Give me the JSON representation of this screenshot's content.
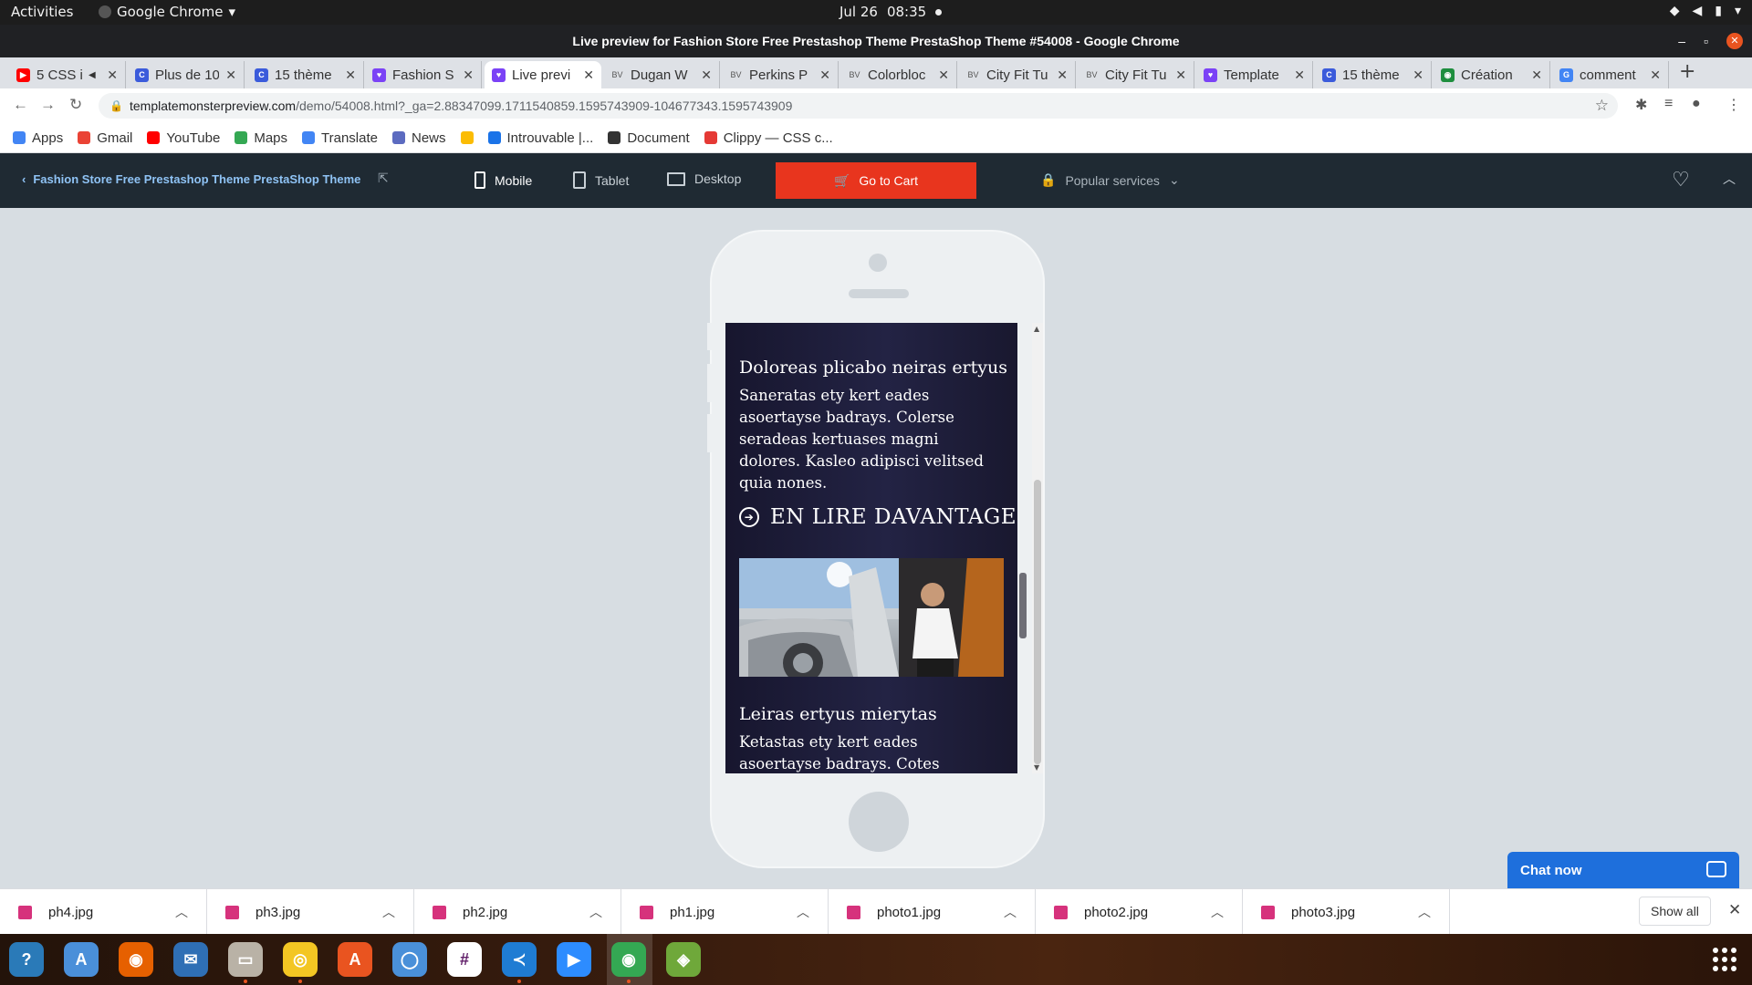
{
  "system_bar": {
    "activities": "Activities",
    "app_name": "Google Chrome",
    "date": "Jul 26",
    "time": "08:35"
  },
  "window": {
    "title": "Live preview for Fashion Store Free Prestashop Theme PrestaShop Theme #54008 - Google Chrome"
  },
  "tabs": [
    {
      "label": "5 CSS i",
      "icon": "youtube-icon",
      "color": "#ff0000",
      "muted": true
    },
    {
      "label": "Plus de 10",
      "icon": "c-icon",
      "color": "#3b5bdb"
    },
    {
      "label": "15 thème",
      "icon": "c-icon",
      "color": "#3b5bdb"
    },
    {
      "label": "Fashion S",
      "icon": "templatemonster-icon",
      "color": "#7b42f6"
    },
    {
      "label": "Live previ",
      "icon": "templatemonster-icon",
      "color": "#7b42f6",
      "active": true
    },
    {
      "label": "Dugan W",
      "icon": "bv-icon",
      "color": "#555555"
    },
    {
      "label": "Perkins P",
      "icon": "bv-icon",
      "color": "#555555"
    },
    {
      "label": "Colorbloc",
      "icon": "bv-icon",
      "color": "#555555"
    },
    {
      "label": "City Fit Tu",
      "icon": "bv-icon",
      "color": "#555555"
    },
    {
      "label": "City Fit Tu",
      "icon": "bv-icon",
      "color": "#555555"
    },
    {
      "label": "Template",
      "icon": "templatemonster-icon",
      "color": "#7b42f6"
    },
    {
      "label": "15 thème",
      "icon": "c-icon",
      "color": "#3b5bdb"
    },
    {
      "label": "Création",
      "icon": "globe-icon",
      "color": "#1e8e3e"
    },
    {
      "label": "comment",
      "icon": "google-icon",
      "color": "#4285f4"
    }
  ],
  "address_bar": {
    "domain": "templatemonsterpreview.com",
    "path": "/demo/54008.html?_ga=2.88347099.1711540859.1595743909-104677343.1595743909"
  },
  "bookmarks": [
    {
      "label": "Apps",
      "icon": "apps-grid-icon",
      "color": "#4285f4"
    },
    {
      "label": "Gmail",
      "icon": "gmail-icon",
      "color": "#ea4335"
    },
    {
      "label": "YouTube",
      "icon": "youtube-icon",
      "color": "#ff0000"
    },
    {
      "label": "Maps",
      "icon": "maps-icon",
      "color": "#34a853"
    },
    {
      "label": "Translate",
      "icon": "translate-icon",
      "color": "#4285f4"
    },
    {
      "label": "News",
      "icon": "news-icon",
      "color": "#5c6bc0"
    },
    {
      "label": "",
      "icon": "drive-icon",
      "color": "#fbbc04"
    },
    {
      "label": "Introuvable |...",
      "icon": "page-icon",
      "color": "#1a73e8"
    },
    {
      "label": "Document",
      "icon": "github-icon",
      "color": "#333333"
    },
    {
      "label": "Clippy — CSS c...",
      "icon": "clippy-icon",
      "color": "#e53935"
    }
  ],
  "preview_header": {
    "back_label": "Fashion Store Free Prestashop Theme PrestaShop Theme",
    "devices": [
      {
        "label": "Mobile",
        "icon": "mobile-icon",
        "active": true
      },
      {
        "label": "Tablet",
        "icon": "tablet-icon",
        "active": false
      },
      {
        "label": "Desktop",
        "icon": "desktop-icon",
        "active": false
      }
    ],
    "cart_label": "Go to Cart",
    "popular_label": "Popular services",
    "cart_color": "#e8351e"
  },
  "mobile_content": {
    "article1": {
      "title": "Doloreas plicabo neiras ertyus",
      "body": "Saneratas ety kert eades asoertayse badrays. Colerse seradeas kertuases magni dolores. Kasleo adipisci velitsed quia nones."
    },
    "read_more": "EN LIRE DAVANTAGE",
    "article2": {
      "title": "Leiras ertyus mierytas",
      "body": "Ketastas ety kert eades asoertayse badrays. Cotes nesciunt neque porro"
    }
  },
  "chat": {
    "label": "Chat now",
    "color": "#1e6fdc"
  },
  "downloads": {
    "files": [
      "ph4.jpg",
      "ph3.jpg",
      "ph2.jpg",
      "ph1.jpg",
      "photo1.jpg",
      "photo2.jpg",
      "photo3.jpg"
    ],
    "show_all": "Show all"
  },
  "dock": [
    {
      "name": "help",
      "icon": "help-icon",
      "color": "#2a7ab8"
    },
    {
      "name": "translator",
      "icon": "translate-icon",
      "color": "#4a8fd9"
    },
    {
      "name": "firefox",
      "icon": "firefox-icon",
      "color": "#e66000"
    },
    {
      "name": "thunderbird",
      "icon": "thunderbird-icon",
      "color": "#2f6fb5"
    },
    {
      "name": "files",
      "icon": "files-icon",
      "color": "#b9b2a6"
    },
    {
      "name": "rhythmbox",
      "icon": "rhythmbox-icon",
      "color": "#f3c623"
    },
    {
      "name": "software",
      "icon": "software-icon",
      "color": "#e95420"
    },
    {
      "name": "chromium",
      "icon": "chromium-icon",
      "color": "#4a90d9"
    },
    {
      "name": "slack",
      "icon": "slack-icon",
      "color": "#ffffff"
    },
    {
      "name": "vscode",
      "icon": "vscode-icon",
      "color": "#1f7cd3"
    },
    {
      "name": "zoom",
      "icon": "zoom-icon",
      "color": "#2d8cff"
    },
    {
      "name": "chrome",
      "icon": "chrome-icon",
      "color": "#34a853"
    },
    {
      "name": "network",
      "icon": "network-icon",
      "color": "#6fa83a"
    }
  ]
}
